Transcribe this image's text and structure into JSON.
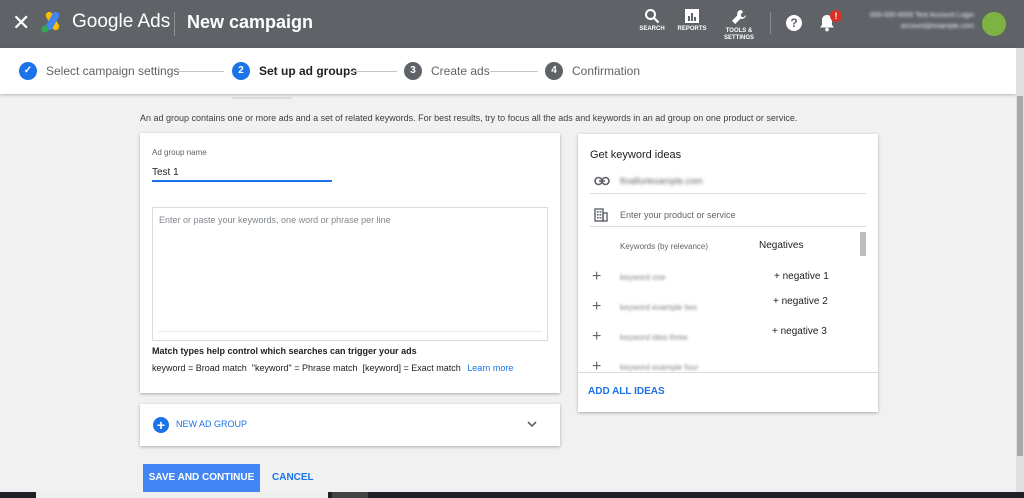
{
  "header": {
    "close_icon": "close-icon",
    "brand": "Google Ads",
    "page_title": "New campaign",
    "tools": [
      {
        "label": "SEARCH",
        "icon": "search-icon"
      },
      {
        "label": "REPORTS",
        "icon": "reports-icon"
      },
      {
        "label": "TOOLS & SETTINGS",
        "icon": "wrench-icon"
      }
    ],
    "help_glyph": "?",
    "notification_count": "!",
    "account_line1": "000-000-0000 Test Account Login",
    "account_line2": "account@example.com"
  },
  "stepper": {
    "steps": [
      {
        "number": "✓",
        "label": "Select campaign settings",
        "state": "done"
      },
      {
        "number": "2",
        "label": "Set up ad groups",
        "state": "active"
      },
      {
        "number": "3",
        "label": "Create ads",
        "state": "pending"
      },
      {
        "number": "4",
        "label": "Confirmation",
        "state": "pending"
      }
    ]
  },
  "intro": "An ad group contains one or more ads and a set of related keywords. For best results, try to focus all the ads and keywords in an ad group on one product or service.",
  "ad_group": {
    "name_label": "Ad group name",
    "name_value": "Test 1",
    "keywords_placeholder": "Enter or paste your keywords, one word or phrase per line",
    "match_title": "Match types help control which searches can trigger your ads",
    "match_text": "keyword = Broad match  \"keyword\" = Phrase match  [keyword] = Exact match",
    "learn_more": "Learn more"
  },
  "new_ad_group": {
    "plus": "+",
    "label": "NEW AD GROUP"
  },
  "actions": {
    "save": "SAVE AND CONTINUE",
    "cancel": "CANCEL"
  },
  "keyword_ideas": {
    "title": "Get keyword ideas",
    "url": "finalfurlexample.com",
    "product_placeholder": "Enter your product or service",
    "col_keywords": "Keywords (by relevance)",
    "col_negatives": "Negatives",
    "ideas": [
      {
        "plus": "+",
        "keyword": "keyword one",
        "negative": "+ negative 1"
      },
      {
        "plus": "+",
        "keyword": "keyword example two",
        "negative": "+ negative 2"
      },
      {
        "plus": "+",
        "keyword": "keyword idea three",
        "negative": "+ negative 3"
      },
      {
        "plus": "+",
        "keyword": "keyword example four",
        "negative": ""
      }
    ],
    "add_all": "ADD ALL IDEAS"
  },
  "colors": {
    "header_bg": "#5f6368",
    "accent": "#1a73e8",
    "primary_button": "#4285f4",
    "step_done": "#1a73e8",
    "step_pending": "#5f6368",
    "notification_badge": "#d93025"
  }
}
